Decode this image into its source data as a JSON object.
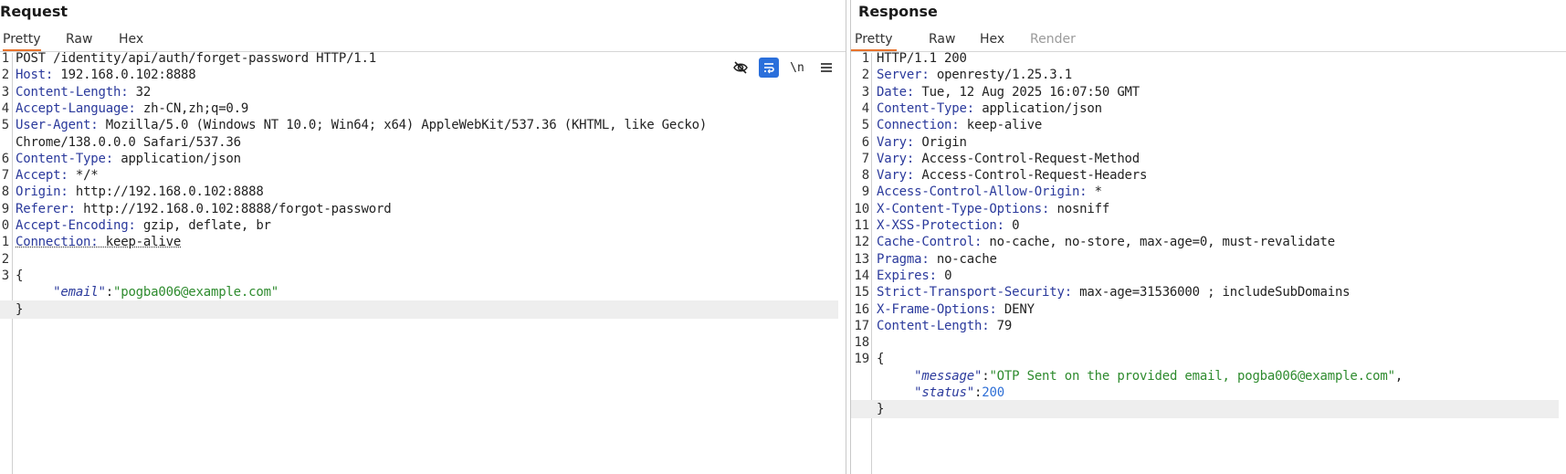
{
  "request": {
    "title": "Request",
    "tabs": [
      "Pretty",
      "Raw",
      "Hex"
    ],
    "active_tab": "Pretty",
    "toolbar": {
      "hide_icon": "eye-slash-icon",
      "wrap_icon": "word-wrap-icon",
      "newline_label": "\\n",
      "menu_icon": "hamburger-menu-icon"
    },
    "lines": [
      {
        "num": "1",
        "text": "POST /identity/api/auth/forget-password HTTP/1.1"
      },
      {
        "num": "2",
        "key": "Host",
        "val": " 192.168.0.102:8888"
      },
      {
        "num": "3",
        "key": "Content-Length",
        "val": " 32"
      },
      {
        "num": "4",
        "key": "Accept-Language",
        "val": " zh-CN,zh;q=0.9"
      },
      {
        "num": "5",
        "key": "User-Agent",
        "val": " Mozilla/5.0 (Windows NT 10.0; Win64; x64) AppleWebKit/537.36 (KHTML, like Gecko)"
      },
      {
        "num": "",
        "text": "Chrome/138.0.0.0 Safari/537.36"
      },
      {
        "num": "6",
        "key": "Content-Type",
        "val": " application/json"
      },
      {
        "num": "7",
        "key": "Accept",
        "val": " */*"
      },
      {
        "num": "8",
        "key": "Origin",
        "val": " http://192.168.0.102:8888"
      },
      {
        "num": "9",
        "key": "Referer",
        "val": " http://192.168.0.102:8888/forgot-password"
      },
      {
        "num": "0",
        "key": "Accept-Encoding",
        "val": " gzip, deflate, br"
      },
      {
        "num": "1",
        "key": "Connection",
        "val": " keep-alive",
        "dotted": true
      },
      {
        "num": "2",
        "text": ""
      },
      {
        "num": "3",
        "text": "{"
      },
      {
        "num": "",
        "jkey": "\"email\"",
        "jsep": ":",
        "jval": "\"pogba006@example.com\""
      },
      {
        "num": "",
        "text": "}",
        "highlight": true
      }
    ]
  },
  "response": {
    "title": "Response",
    "tabs": [
      "Pretty",
      "Raw",
      "Hex",
      "Render"
    ],
    "active_tab": "Pretty",
    "lines": [
      {
        "num": "1",
        "text": "HTTP/1.1 200"
      },
      {
        "num": "2",
        "key": "Server",
        "val": " openresty/1.25.3.1"
      },
      {
        "num": "3",
        "key": "Date",
        "val": " Tue, 12 Aug 2025 16:07:50 GMT"
      },
      {
        "num": "4",
        "key": "Content-Type",
        "val": " application/json"
      },
      {
        "num": "5",
        "key": "Connection",
        "val": " keep-alive"
      },
      {
        "num": "6",
        "key": "Vary",
        "val": " Origin"
      },
      {
        "num": "7",
        "key": "Vary",
        "val": " Access-Control-Request-Method"
      },
      {
        "num": "8",
        "key": "Vary",
        "val": " Access-Control-Request-Headers"
      },
      {
        "num": "9",
        "key": "Access-Control-Allow-Origin",
        "val": " *"
      },
      {
        "num": "10",
        "key": "X-Content-Type-Options",
        "val": " nosniff"
      },
      {
        "num": "11",
        "key": "X-XSS-Protection",
        "val": " 0"
      },
      {
        "num": "12",
        "key": "Cache-Control",
        "val": " no-cache, no-store, max-age=0, must-revalidate"
      },
      {
        "num": "13",
        "key": "Pragma",
        "val": " no-cache"
      },
      {
        "num": "14",
        "key": "Expires",
        "val": " 0"
      },
      {
        "num": "15",
        "key": "Strict-Transport-Security",
        "val": " max-age=31536000 ; includeSubDomains"
      },
      {
        "num": "16",
        "key": "X-Frame-Options",
        "val": " DENY"
      },
      {
        "num": "17",
        "key": "Content-Length",
        "val": " 79"
      },
      {
        "num": "18",
        "text": ""
      },
      {
        "num": "19",
        "text": "{"
      },
      {
        "num": "",
        "jkey": "\"message\"",
        "jsep": ":",
        "jval": "\"OTP Sent on the provided email, pogba006@example.com\"",
        "trail": ","
      },
      {
        "num": "",
        "jkey": "\"status\"",
        "jsep": ":",
        "jnum": "200"
      },
      {
        "num": "",
        "text": "}",
        "highlight": true
      }
    ]
  },
  "colors": {
    "header_key": "#2b3a9c",
    "json_string": "#2e8b2e",
    "json_number": "#2e6fd6",
    "active_tab_underline": "#e8732c",
    "wrap_button_bg": "#2a6fdb"
  }
}
